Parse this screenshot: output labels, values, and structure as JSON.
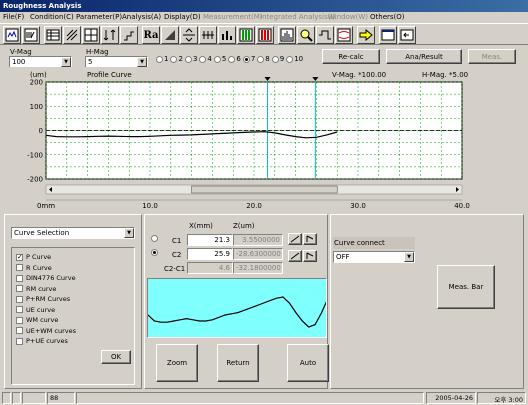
{
  "window": {
    "title": "Roughness Analysis"
  },
  "menu": [
    {
      "label": "File(F)",
      "enabled": true
    },
    {
      "label": "Condition(C)",
      "enabled": true
    },
    {
      "label": "Parameter(P)",
      "enabled": true
    },
    {
      "label": "Analysis(A)",
      "enabled": true
    },
    {
      "label": "Display(D)",
      "enabled": true
    },
    {
      "label": "Measurement(M)",
      "enabled": false
    },
    {
      "label": "Integrated Analysis(I)",
      "enabled": false
    },
    {
      "label": "Window(W)",
      "enabled": false
    },
    {
      "label": "Others(O)",
      "enabled": true
    }
  ],
  "toolbar": {
    "icons": [
      "profile-view-icon",
      "wave-select-icon",
      "table-icon",
      "hatch-icon",
      "grid-icon",
      "arrows-icon",
      "step-icon",
      "ra-parameter-icon",
      "bearing-curve-icon",
      "level-adjust-icon",
      "peak-count-icon",
      "bar-chart-icon",
      "green-bars-icon",
      "red-bars-icon",
      "histogram-icon",
      "magnify-icon",
      "filter-icon",
      "overlay-icon",
      "arrow-right-icon",
      "window-tile-icon",
      "window-back-icon"
    ],
    "ra_label": "Ra"
  },
  "magnification": {
    "v_label": "V-Mag",
    "v_value": "100",
    "h_label": "H-Mag",
    "h_value": "5"
  },
  "curve_radio": {
    "options": [
      "1",
      "2",
      "3",
      "4",
      "5",
      "6",
      "7",
      "8",
      "9",
      "10"
    ],
    "selected": "7"
  },
  "buttons": {
    "recalc": "Re-calc",
    "ana_result": "Ana/Result",
    "meas": "Meas.",
    "ok": "OK",
    "meas_bar": "Meas. Bar",
    "zoom": "Zoom",
    "return": "Return",
    "auto": "Auto"
  },
  "chart_header": {
    "unit": "(um)",
    "title": "Profile Curve",
    "vmag": "V-Mag.  *100.00",
    "hmag": "H-Mag.  *5.00"
  },
  "chart_data": {
    "type": "line",
    "title": "Profile Curve",
    "xlabel": "",
    "ylabel": "(um)",
    "xlim": [
      0,
      40
    ],
    "ylim": [
      -200,
      200
    ],
    "y_ticks": [
      "200",
      "100",
      "0",
      "-100",
      "-200"
    ],
    "x_ticks": [
      "0mm",
      "10.0",
      "20.0",
      "30.0",
      "40.0"
    ],
    "x_tick_values": [
      0,
      10,
      20,
      30,
      40
    ],
    "grid": true,
    "cursor_c1_mm": 21.3,
    "cursor_c2_mm": 25.9,
    "series": [
      {
        "x": [
          0,
          1,
          2,
          3,
          4,
          5,
          6,
          7,
          8,
          9,
          10,
          11,
          12,
          13,
          14,
          15,
          16,
          17,
          18,
          19,
          20,
          21,
          22,
          23,
          24,
          25,
          26,
          27,
          28
        ],
        "y": [
          -20,
          -25,
          -26,
          -26,
          -25,
          -24,
          -23,
          -24,
          -25,
          -25,
          -24,
          -22,
          -20,
          -19,
          -18,
          -16,
          -14,
          -12,
          -10,
          -8,
          -6,
          -5,
          -10,
          -18,
          -25,
          -30,
          -28,
          -18,
          -6
        ]
      }
    ]
  },
  "curve_selection": {
    "dropdown": "Curve Selection",
    "items": [
      {
        "label": "P Curve",
        "checked": true
      },
      {
        "label": "R Curve",
        "checked": false
      },
      {
        "label": "DIN4776 Curve",
        "checked": false
      },
      {
        "label": "RM curve",
        "checked": false
      },
      {
        "label": "P+RM Curves",
        "checked": false
      },
      {
        "label": "UE curve",
        "checked": false
      },
      {
        "label": "WM curve",
        "checked": false
      },
      {
        "label": "UE+WM curves",
        "checked": false
      },
      {
        "label": "P+UE curves",
        "checked": false
      }
    ]
  },
  "cursor_table": {
    "x_header": "X(mm)",
    "z_header": "Z(um)",
    "rows": [
      {
        "label": "C1",
        "x": "21.3",
        "z": "3.5500000",
        "selected": false
      },
      {
        "label": "C2",
        "x": "25.9",
        "z": "-28.6300000",
        "selected": true
      },
      {
        "label": "C2-C1",
        "x": "4.6",
        "z": "-32.1800000",
        "selected": false
      }
    ]
  },
  "curve_connect": {
    "label": "Curve connect",
    "value": "OFF"
  },
  "statusbar": {
    "count": "88",
    "date": "2005-04-26",
    "time": "오후 3:00"
  },
  "colors": {
    "chart_bg": "#ffffff",
    "grid": "#00a000",
    "cursor": "#00c0c0",
    "preview_bg": "#80ffff",
    "titlebar": "#0a246a"
  }
}
